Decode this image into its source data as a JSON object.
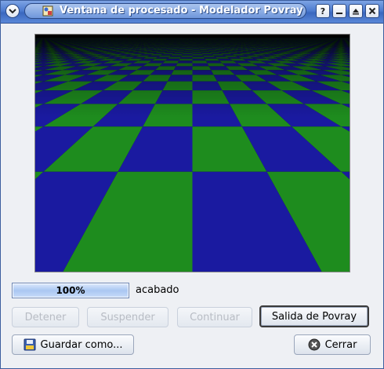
{
  "window": {
    "title": "Ventana de procesado - Modelador Povray",
    "icons": {
      "menu": "window-menu-icon",
      "app": "povray-app-icon",
      "help": "help-icon",
      "minimize": "minimize-icon",
      "maximize": "maximize-icon",
      "close": "close-icon"
    },
    "title_bar_color": "#4d7bd0"
  },
  "render": {
    "colors": {
      "tile_a": "#1e8c1e",
      "tile_b": "#1a1aa0",
      "sky": "#000000"
    }
  },
  "progress": {
    "value": 100,
    "label": "100%",
    "status": "acabado"
  },
  "buttons": {
    "stop": "Detener",
    "suspend": "Suspender",
    "continue": "Continuar",
    "povray_output": "Salida de Povray",
    "save_as": "Guardar como...",
    "close": "Cerrar"
  }
}
